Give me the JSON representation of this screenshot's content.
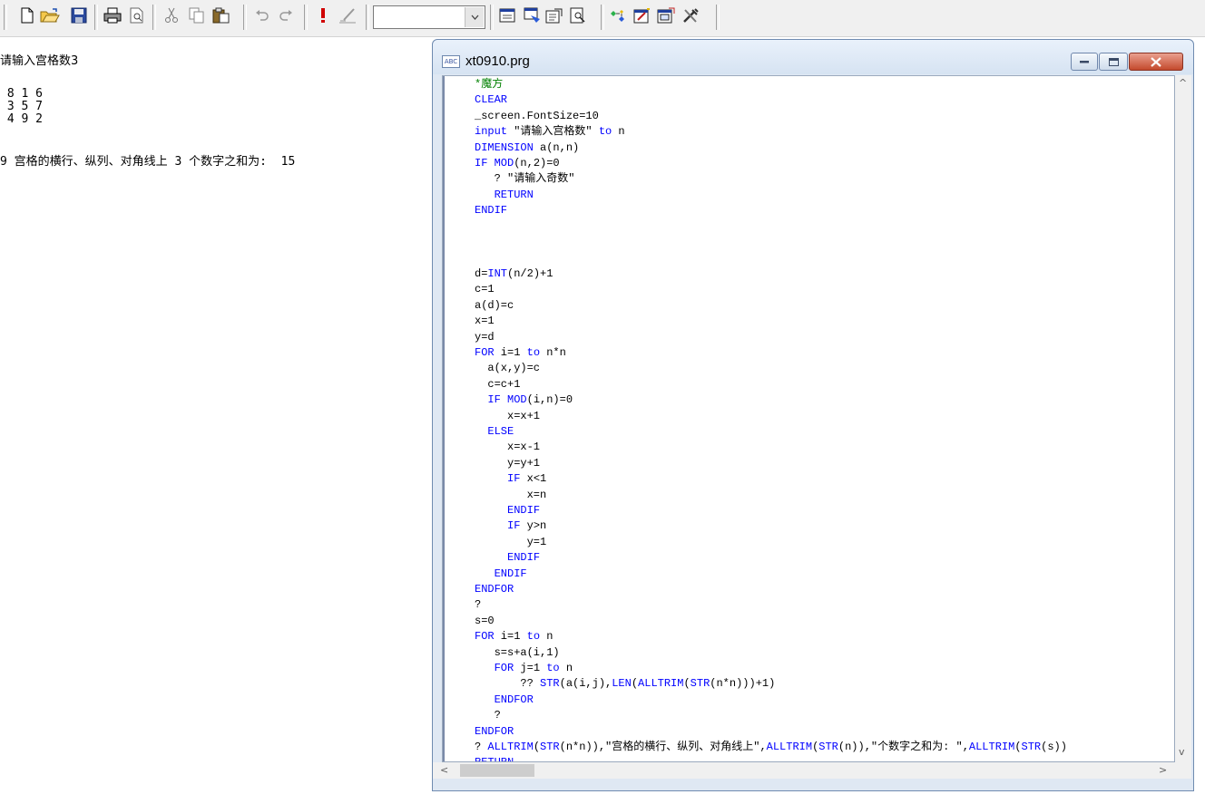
{
  "toolbar": {
    "combo_value": "",
    "buttons": [
      "new-file",
      "open-folder",
      "save",
      "print",
      "print-preview",
      "cut",
      "copy",
      "paste",
      "undo",
      "redo",
      "run",
      "modify-form",
      "combo",
      "form-designer",
      "properties",
      "code-window",
      "view-report",
      "class-browser",
      "form-wizard",
      "datasession",
      "builder-tools"
    ]
  },
  "output": {
    "prompt": "请输入宫格数3",
    "grid_rows": [
      " 8 1 6",
      " 3 5 7",
      " 4 9 2"
    ],
    "summary": "9 宫格的横行、纵列、对角线上 3 个数字之和为:  15"
  },
  "editor": {
    "title": "xt0910.prg",
    "icon_label": "ABC",
    "code_lines": [
      "*魔方",
      "CLEAR",
      "_screen.FontSize=10",
      "input \"请输入宫格数\" to n",
      "DIMENSION a(n,n)",
      "IF MOD(n,2)=0",
      "   ? \"请输入奇数\"",
      "   RETURN",
      "ENDIF",
      "",
      "",
      "",
      "d=INT(n/2)+1",
      "c=1",
      "a(d)=c",
      "x=1",
      "y=d",
      "FOR i=1 to n*n",
      "  a(x,y)=c",
      "  c=c+1",
      "  IF MOD(i,n)=0",
      "     x=x+1",
      "  ELSE",
      "     x=x-1",
      "     y=y+1",
      "     IF x<1",
      "        x=n",
      "     ENDIF",
      "     IF y>n",
      "        y=1",
      "     ENDIF",
      "   ENDIF",
      "ENDFOR",
      "?",
      "s=0",
      "FOR i=1 to n",
      "   s=s+a(i,1)",
      "   FOR j=1 to n",
      "       ?? STR(a(i,j),LEN(ALLTRIM(STR(n*n)))+1)",
      "   ENDFOR",
      "   ?",
      "ENDFOR",
      "? ALLTRIM(STR(n*n)),\"宫格的横行、纵列、对角线上\",ALLTRIM(STR(n)),\"个数字之和为: \",ALLTRIM(STR(s))",
      "RETURN"
    ]
  },
  "colors": {
    "keyword": "#0000ff",
    "comment": "#008000",
    "text": "#000000"
  }
}
